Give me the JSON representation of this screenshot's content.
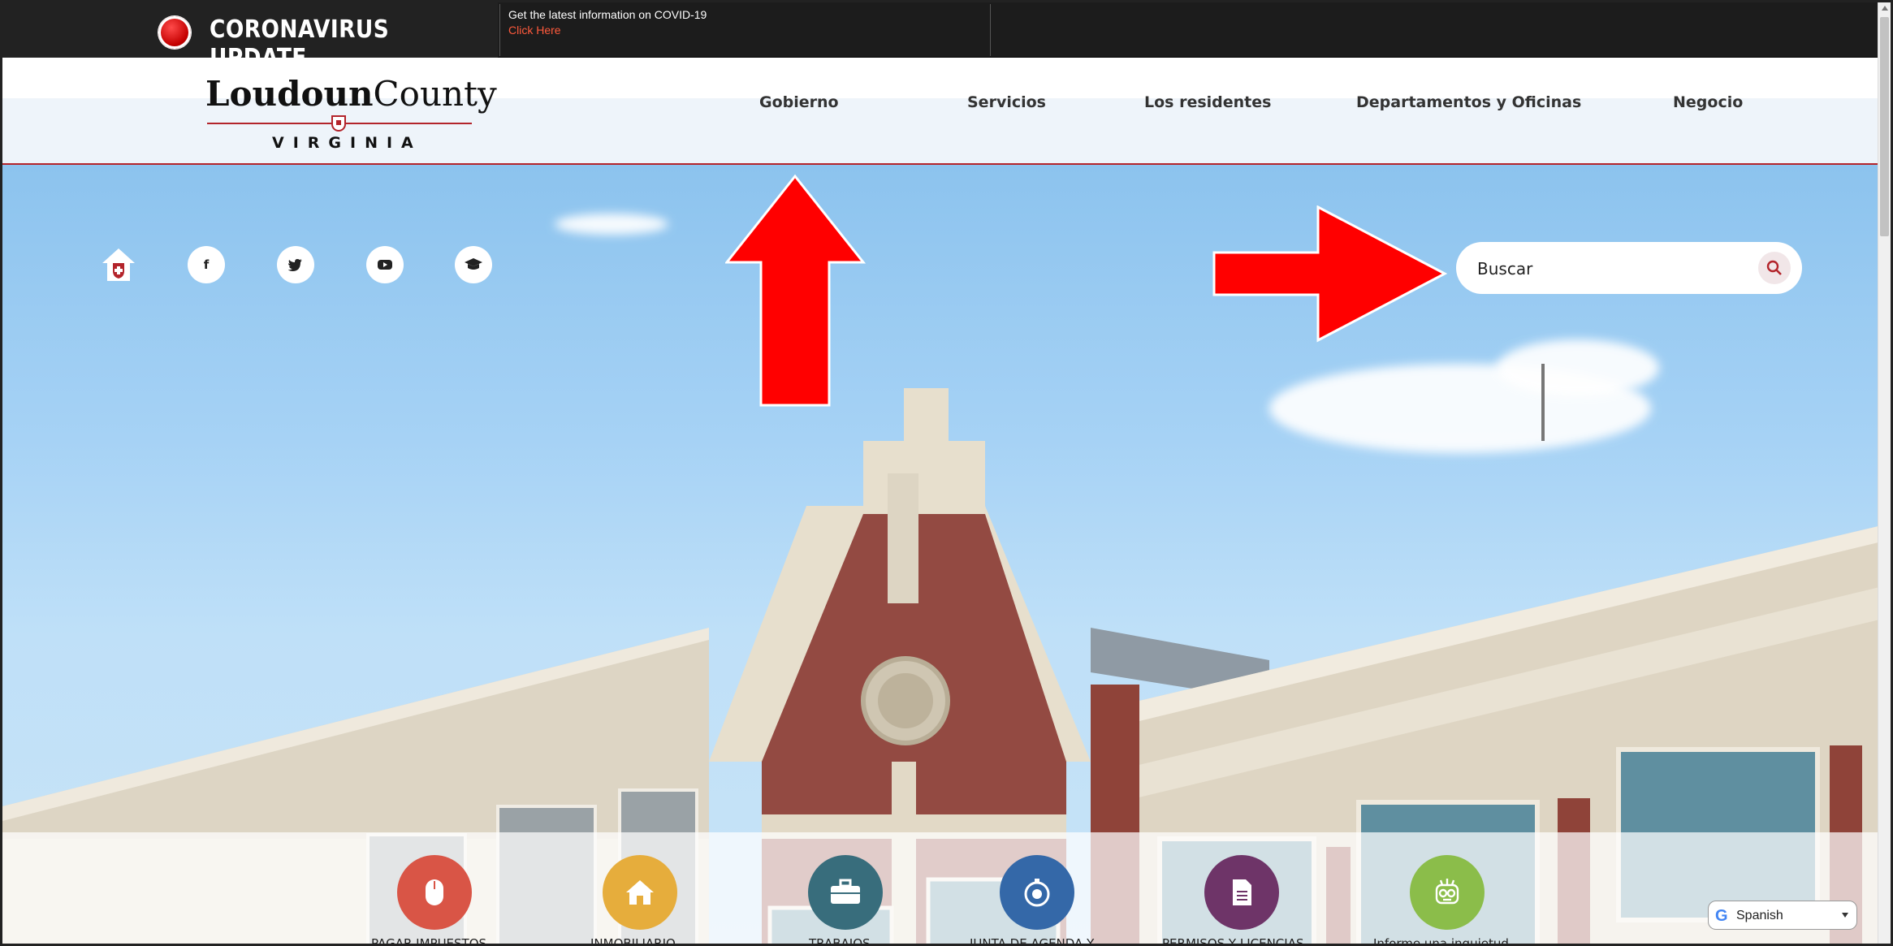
{
  "alert": {
    "title": "CORONAVIRUS UPDATE",
    "message": "Get the latest information on COVID-19",
    "link_text": "Click Here"
  },
  "header": {
    "logo_main_bold": "Loudoun",
    "logo_main_light": "County",
    "logo_sub": "VIRGINIA",
    "nav": [
      "Gobierno",
      "Servicios",
      "Los residentes",
      "Departamentos y Oficinas",
      "Negocio"
    ]
  },
  "hero": {
    "social_icons": [
      "home-shield-icon",
      "facebook-icon",
      "twitter-icon",
      "youtube-icon",
      "mortarboard-icon"
    ],
    "search_placeholder": "Buscar"
  },
  "quick_links": [
    {
      "label": "PAGAR IMPUESTOS",
      "icon": "mouse-icon",
      "color": "#d95546"
    },
    {
      "label": "INMOBILIARIO",
      "icon": "house-icon",
      "color": "#e6ad3c"
    },
    {
      "label": "TRABAJOS",
      "icon": "briefcase-icon",
      "color": "#386d7c"
    },
    {
      "label": "JUNTA DE AGENDA Y",
      "icon": "stopwatch-icon",
      "color": "#3468a8"
    },
    {
      "label": "PERMISOS Y LICENCIAS",
      "icon": "document-icon",
      "color": "#6e3468"
    },
    {
      "label": "Informe una inquietud",
      "icon": "robot-icon",
      "color": "#8bbd4a"
    }
  ],
  "language": {
    "selected": "Spanish"
  },
  "colors": {
    "brand_red": "#b3242b",
    "alert_bg": "#1c1c1c",
    "link_orange": "#ff5a3c",
    "arrow_red": "#ff0000"
  }
}
